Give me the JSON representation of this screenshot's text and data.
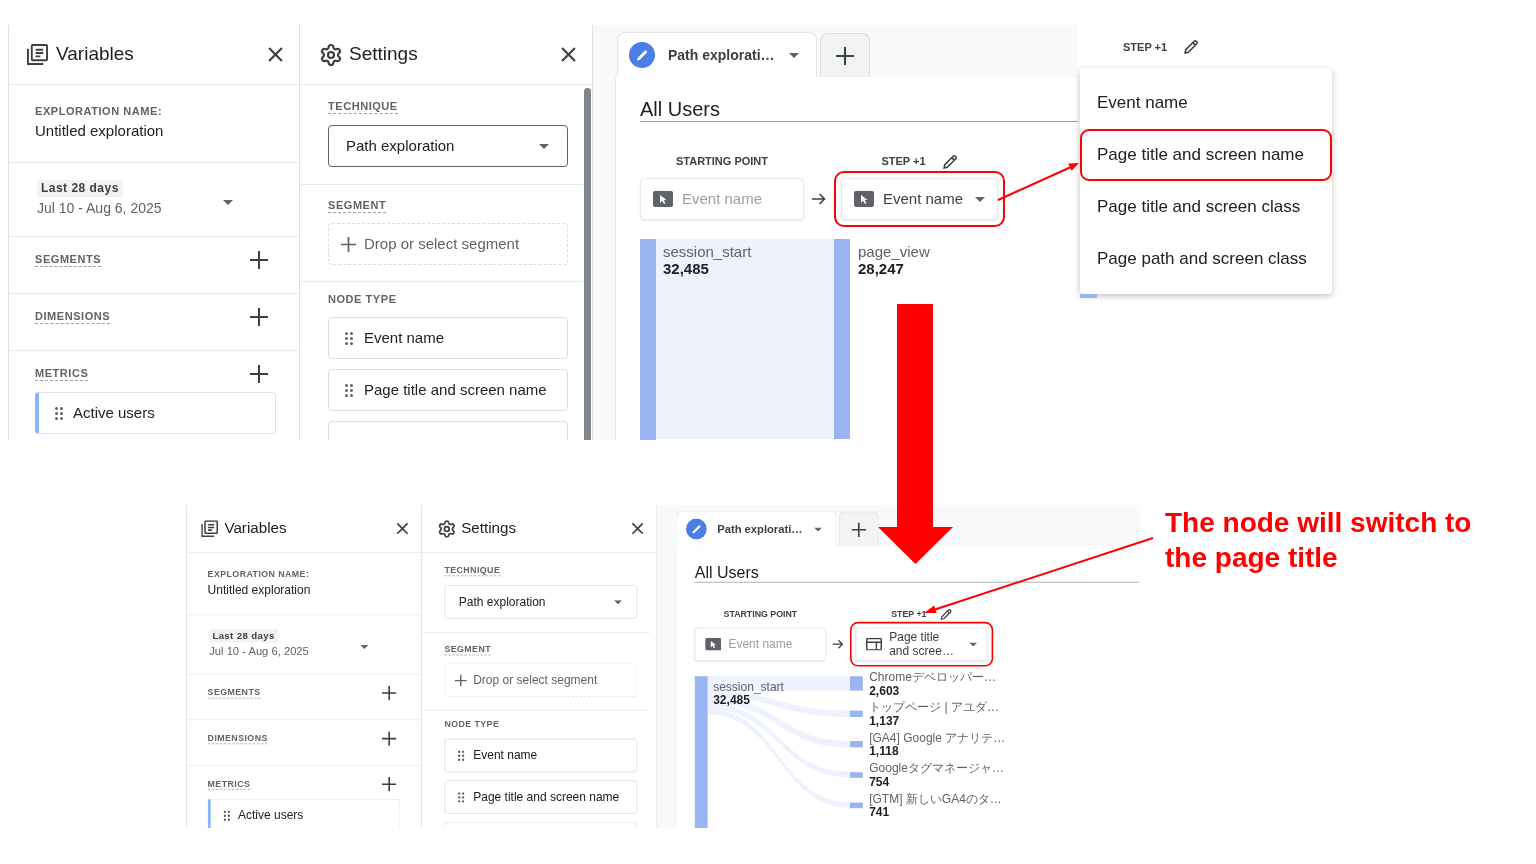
{
  "screenshots": [
    {
      "variables": {
        "title": "Variables",
        "exploration_name_label": "EXPLORATION NAME:",
        "exploration_name": "Untitled exploration",
        "date_preset": "Last 28 days",
        "date_range": "Jul 10 - Aug 6, 2025",
        "sections": [
          {
            "label": "SEGMENTS"
          },
          {
            "label": "DIMENSIONS"
          },
          {
            "label": "METRICS",
            "items": [
              {
                "label": "Active users"
              }
            ]
          }
        ]
      },
      "settings": {
        "title": "Settings",
        "technique_label": "TECHNIQUE",
        "technique": {
          "value": "Path exploration",
          "focused": true
        },
        "segment_label": "SEGMENT",
        "segment_dropzone": "Drop or select segment",
        "node_type_label": "NODE TYPE",
        "node_types": [
          {
            "kind": "option",
            "label": "Event name"
          },
          {
            "kind": "option",
            "label": "Page title and screen name"
          },
          {
            "kind": "clipped"
          }
        ]
      },
      "exploration": {
        "tabs": [
          {
            "label": "Path explorati…",
            "selected": true
          }
        ],
        "segment_name": "All Users",
        "starting_point_label": "STARTING POINT",
        "step_label": "STEP +1",
        "starting_node": {
          "kind": "event",
          "label": "Event name",
          "disabled": true
        },
        "step_node": {
          "kind": "event",
          "label": "Event name",
          "disabled": false,
          "highlighted": true
        },
        "start_nodes": [
          {
            "name": "session_start",
            "count": "32,485"
          }
        ],
        "step_nodes": [
          {
            "name": "page_view",
            "count": "28,247"
          }
        ]
      },
      "node_menu": {
        "step_label": "STEP +1",
        "items": [
          {
            "label": "Event name",
            "highlighted": false
          },
          {
            "label": "Page title and screen name",
            "highlighted": true
          },
          {
            "label": "Page title and screen class",
            "highlighted": false
          },
          {
            "label": "Page path and screen class",
            "highlighted": false
          }
        ]
      }
    },
    {
      "variables": {
        "title": "Variables",
        "exploration_name_label": "EXPLORATION NAME:",
        "exploration_name": "Untitled exploration",
        "date_preset": "Last 28 days",
        "date_range": "Jul 10 - Aug 6, 2025",
        "sections": [
          {
            "label": "SEGMENTS"
          },
          {
            "label": "DIMENSIONS"
          },
          {
            "label": "METRICS",
            "items": [
              {
                "label": "Active users"
              }
            ]
          }
        ]
      },
      "settings": {
        "title": "Settings",
        "technique_label": "TECHNIQUE",
        "technique": {
          "value": "Path exploration",
          "focused": false
        },
        "segment_label": "SEGMENT",
        "segment_dropzone": "Drop or select segment",
        "node_type_label": "NODE TYPE",
        "node_types": [
          {
            "kind": "option",
            "label": "Event name"
          },
          {
            "kind": "option",
            "label": "Page title and screen name"
          },
          {
            "kind": "clipped"
          }
        ]
      },
      "exploration": {
        "tabs": [
          {
            "label": "Path explorati…",
            "selected": true
          }
        ],
        "segment_name": "All Users",
        "starting_point_label": "STARTING POINT",
        "step_label": "STEP +1",
        "starting_node": {
          "kind": "event",
          "label": "Event name",
          "disabled": true
        },
        "step_node": {
          "kind": "page",
          "label": "Page title and scree…",
          "disabled": false,
          "highlighted": true
        },
        "start_nodes": [
          {
            "name": "session_start",
            "count": "32,485"
          }
        ],
        "step_nodes": [
          {
            "name": "Chromeデベロッパー…",
            "count": "2,603"
          },
          {
            "name": "トップページ | アユダ…",
            "count": "1,137"
          },
          {
            "name": "[GA4] Google アナリテ…",
            "count": "1,118"
          },
          {
            "name": "Googleタグマネージャ…",
            "count": "754"
          },
          {
            "name": "[GTM] 新しいGA4のタ…",
            "count": "741"
          }
        ]
      }
    }
  ],
  "callout": {
    "text": "The node will switch to the page title"
  }
}
